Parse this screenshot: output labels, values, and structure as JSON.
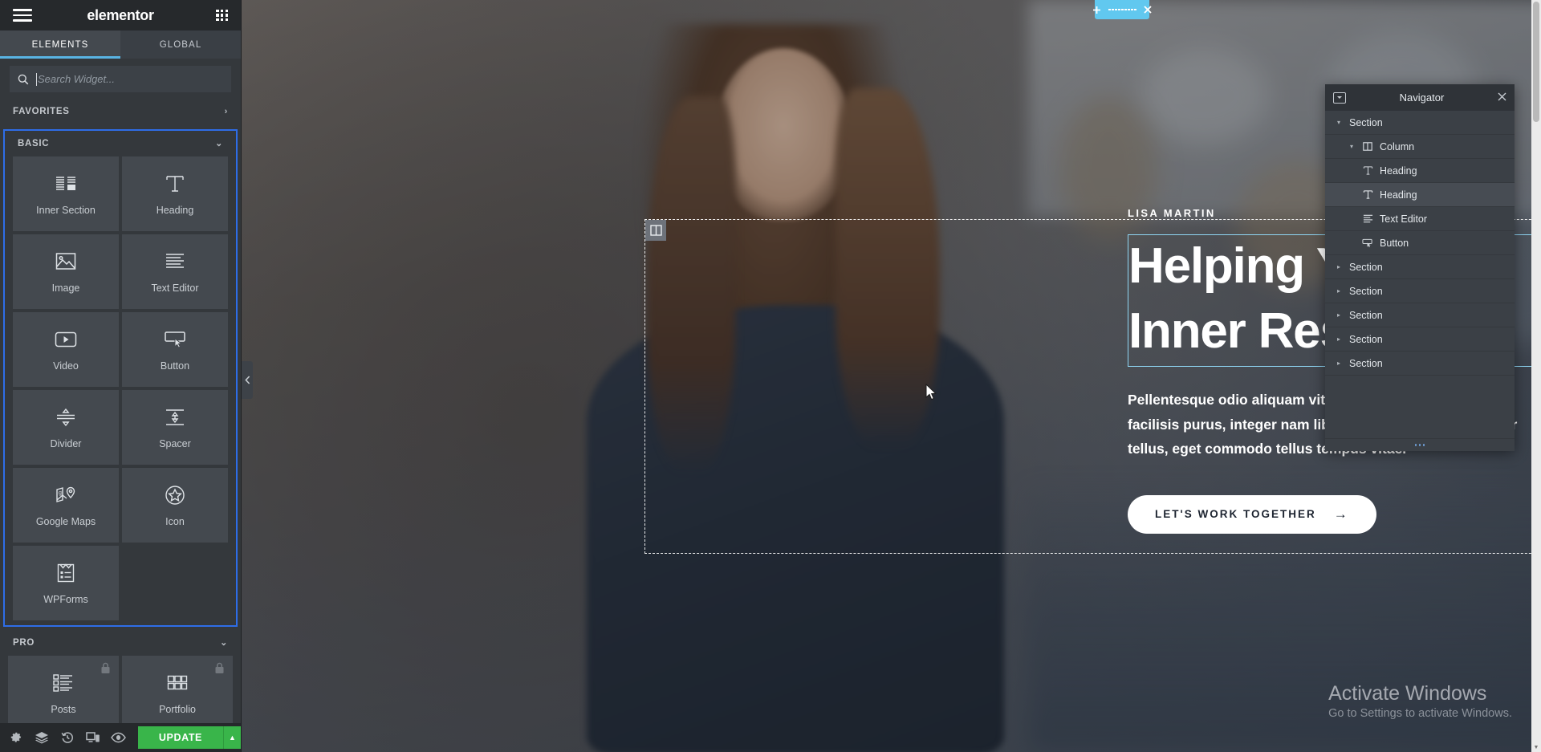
{
  "panel": {
    "brand": "elementor",
    "menu_icon": "hamburger-icon",
    "apps_icon": "grid-apps-icon",
    "tabs": [
      {
        "label": "ELEMENTS",
        "active": true
      },
      {
        "label": "GLOBAL",
        "active": false
      }
    ],
    "search": {
      "placeholder": "Search Widget...",
      "value": "",
      "icon": "search-icon"
    },
    "categories": [
      {
        "label": "FAVORITES",
        "state": "collapsed",
        "chevron": "›"
      },
      {
        "label": "BASIC",
        "state": "expanded",
        "chevron": "⌄"
      },
      {
        "label": "PRO",
        "state": "expanded",
        "chevron": "⌄"
      }
    ],
    "basic_widgets": [
      {
        "label": "Inner Section",
        "icon": "inner-section-icon",
        "pro": false
      },
      {
        "label": "Heading",
        "icon": "heading-icon",
        "pro": false
      },
      {
        "label": "Image",
        "icon": "image-icon",
        "pro": false
      },
      {
        "label": "Text Editor",
        "icon": "text-editor-icon",
        "pro": false
      },
      {
        "label": "Video",
        "icon": "video-icon",
        "pro": false
      },
      {
        "label": "Button",
        "icon": "button-icon",
        "pro": false
      },
      {
        "label": "Divider",
        "icon": "divider-icon",
        "pro": false
      },
      {
        "label": "Spacer",
        "icon": "spacer-icon",
        "pro": false
      },
      {
        "label": "Google Maps",
        "icon": "google-maps-icon",
        "pro": false
      },
      {
        "label": "Icon",
        "icon": "star-icon",
        "pro": false
      },
      {
        "label": "WPForms",
        "icon": "wpforms-icon",
        "pro": false
      }
    ],
    "pro_widgets": [
      {
        "label": "Posts",
        "icon": "posts-icon",
        "pro": true
      },
      {
        "label": "Portfolio",
        "icon": "portfolio-icon",
        "pro": true
      }
    ],
    "footer": {
      "buttons": [
        {
          "name": "settings",
          "icon": "gear-icon"
        },
        {
          "name": "navigator",
          "icon": "layers-icon"
        },
        {
          "name": "history",
          "icon": "history-icon"
        },
        {
          "name": "responsive-mode",
          "icon": "responsive-icon"
        },
        {
          "name": "preview",
          "icon": "eye-icon"
        }
      ],
      "update_label": "UPDATE",
      "update_caret": "▲",
      "update_color": "#39b54a"
    },
    "collapse_icon": "chevron-left-icon"
  },
  "canvas": {
    "section_handle": {
      "add_icon": "plus-icon",
      "drag_icon": "drag-dots-icon",
      "close_icon": "close-icon",
      "color": "#61c8ef"
    },
    "column_handle_icon": "column-icon",
    "hero": {
      "eyebrow": "LISA MARTIN",
      "heading": "Helping You Build Inner Resilience.",
      "heading_line1": "Helping You Buil",
      "heading_line2": "Inner Resilience.",
      "paragraph": "Pellentesque odio aliquam vitae amet, elementum at urna facilisis purus, integer nam libero pharetra viverra et dolor tellus, eget commodo tellus tempus vitae.",
      "cta_label": "LET'S WORK TOGETHER",
      "cta_arrow": "→"
    },
    "cursor_icon": "mouse-pointer-icon"
  },
  "navigator": {
    "title": "Navigator",
    "dock_icon": "dock-icon",
    "close_icon": "close-icon",
    "resize_icon": "resize-dots-icon",
    "items": [
      {
        "label": "Section",
        "depth": 0,
        "arrow": "▾",
        "icon": "",
        "highlight": false
      },
      {
        "label": "Column",
        "depth": 1,
        "arrow": "▾",
        "icon": "column-icon",
        "highlight": false
      },
      {
        "label": "Heading",
        "depth": 2,
        "arrow": "",
        "icon": "heading-icon",
        "highlight": false
      },
      {
        "label": "Heading",
        "depth": 2,
        "arrow": "",
        "icon": "heading-icon",
        "highlight": true
      },
      {
        "label": "Text Editor",
        "depth": 2,
        "arrow": "",
        "icon": "text-editor-icon",
        "highlight": false
      },
      {
        "label": "Button",
        "depth": 2,
        "arrow": "",
        "icon": "button-icon",
        "highlight": false
      },
      {
        "label": "Section",
        "depth": 0,
        "arrow": "▸",
        "icon": "",
        "highlight": false
      },
      {
        "label": "Section",
        "depth": 0,
        "arrow": "▸",
        "icon": "",
        "highlight": false
      },
      {
        "label": "Section",
        "depth": 0,
        "arrow": "▸",
        "icon": "",
        "highlight": false
      },
      {
        "label": "Section",
        "depth": 0,
        "arrow": "▸",
        "icon": "",
        "highlight": false
      },
      {
        "label": "Section",
        "depth": 0,
        "arrow": "▸",
        "icon": "",
        "highlight": false
      }
    ]
  },
  "watermark": {
    "line1": "Activate Windows",
    "line2": "Go to Settings to activate Windows."
  },
  "scrollbar": {
    "up_arrow": "▲",
    "down_arrow": "▼"
  }
}
